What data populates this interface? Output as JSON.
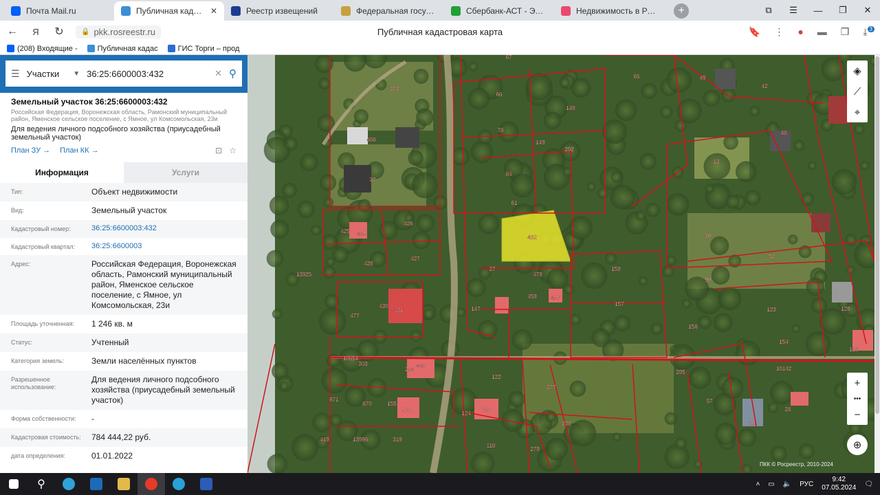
{
  "browser": {
    "tabs": [
      {
        "label": "Почта Mail.ru",
        "color": "#005ff9",
        "active": false
      },
      {
        "label": "Публичная кадастрова",
        "color": "#3a8fd8",
        "active": true
      },
      {
        "label": "Реестр извещений",
        "color": "#1d3c8f",
        "active": false
      },
      {
        "label": "Федеральная государств",
        "color": "#c8a040",
        "active": false
      },
      {
        "label": "Сбербанк-АСТ - Электрон",
        "color": "#21a038",
        "active": false
      },
      {
        "label": "Недвижимость в Рамони",
        "color": "#e94a6f",
        "active": false
      }
    ],
    "url": "pkk.rosreestr.ru",
    "page_title": "Публичная кадастровая карта",
    "bookmarks": [
      {
        "label": "(208) Входящие -",
        "color": "#005ff9"
      },
      {
        "label": "Публичная кадас",
        "color": "#3a8fd8"
      },
      {
        "label": "ГИС Торги – прод",
        "color": "#2d6bd0"
      }
    ],
    "downloads_badge": "3"
  },
  "search": {
    "type": "Участки",
    "query": "36:25:6600003:432"
  },
  "object": {
    "title": "Земельный участок 36:25:6600003:432",
    "address_short": "Российская Федерация, Воронежская область, Рамонский муниципальный район, Яменское сельское поселение, с Ямное, ул Комсомольская, 23и",
    "use": "Для ведения личного подсобного хозяйства (приусадебный земельный участок)",
    "link_plan_zu": "План ЗУ →",
    "link_plan_kk": "План КК →"
  },
  "info_tabs": {
    "info": "Информация",
    "services": "Услуги"
  },
  "attributes": [
    {
      "key": "Тип:",
      "value": "Объект недвижимости",
      "link": false
    },
    {
      "key": "Вид:",
      "value": "Земельный участок",
      "link": false
    },
    {
      "key": "Кадастровый номер:",
      "value": "36:25:6600003:432",
      "link": true
    },
    {
      "key": "Кадастровый квартал:",
      "value": "36:25:6600003",
      "link": true
    },
    {
      "key": "Адрес:",
      "value": "Российская Федерация, Воронежская область, Рамонский муниципальный район, Яменское сельское поселение, с Ямное, ул Комсомольская, 23и",
      "link": false
    },
    {
      "key": "Площадь уточненная:",
      "value": "1 246 кв. м",
      "link": false
    },
    {
      "key": "Статус:",
      "value": "Учтенный",
      "link": false
    },
    {
      "key": "Категория земель:",
      "value": "Земли населённых пунктов",
      "link": false
    },
    {
      "key": "Разрешенное использование:",
      "value": "Для ведения личного подсобного хозяйства (приусадебный земельный участок)",
      "link": false
    },
    {
      "key": "Форма собственности:",
      "value": "-",
      "link": false
    },
    {
      "key": "Кадастровая стоимость:",
      "value": "784 444,22 руб.",
      "link": false
    },
    {
      "key": "дата определения:",
      "value": "01.01.2022",
      "link": false
    }
  ],
  "map": {
    "parcel_labels": [
      "67",
      "65",
      "49",
      "42",
      "373",
      "66",
      "148",
      "78",
      "149",
      "292",
      "48",
      "466",
      "13",
      "37",
      "84",
      "61",
      "426",
      "425",
      "435",
      "428",
      "427",
      "432",
      "13925",
      "27",
      "478",
      "158",
      "20",
      "52",
      "90",
      "459",
      "457",
      "147",
      "157",
      "430",
      "431",
      "477",
      "123",
      "129",
      "156",
      "154",
      "10654",
      "303",
      "204",
      "446",
      "10142",
      "128",
      "122",
      "277",
      "295",
      "671",
      "670",
      "155",
      "572",
      "124",
      "726",
      "278",
      "57",
      "28",
      "449",
      "13996",
      "319",
      "118",
      "279",
      "60"
    ],
    "highlighted_parcel": "432",
    "copyright": "ПКК © Росреестр, 2010-2024"
  },
  "taskbar": {
    "time": "9:42",
    "date": "07.05.2024",
    "lang": "РУС"
  },
  "colors": {
    "accent": "#1f6fb4",
    "boundary": "#d0141a",
    "highlight": "#f2ec2a"
  }
}
